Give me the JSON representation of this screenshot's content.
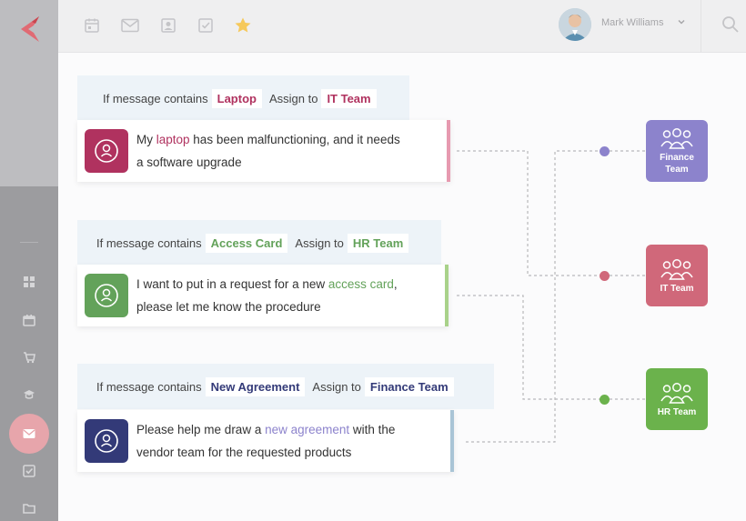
{
  "header": {
    "username": "Mark Williams",
    "icons": [
      "calendar-icon",
      "mail-icon",
      "contact-icon",
      "checkbox-icon",
      "star-icon",
      "search-icon"
    ]
  },
  "sidebar": {
    "icons": [
      "dashboard-icon",
      "calendar-icon",
      "cart-icon",
      "graduation-cap-icon",
      "mail-icon",
      "checkbox-icon",
      "folder-icon"
    ],
    "active": "mail-icon"
  },
  "colors": {
    "laptop": "#b0325f",
    "access": "#63a25a",
    "agreement": "#333a78",
    "it_team": "#d0687a",
    "finance_team": "#8c83cc",
    "hr_team": "#6bb24c"
  },
  "rules": [
    {
      "prefix": "If message contains",
      "keyword": "Laptop",
      "assign": "Assign to",
      "team": "IT Team",
      "message": {
        "before": "My ",
        "highlight": "laptop",
        "after_line1": " has been malfunctioning, and it needs",
        "line2": "a software upgrade"
      }
    },
    {
      "prefix": "If message contains",
      "keyword": "Access Card",
      "assign": "Assign to",
      "team": "HR Team",
      "message": {
        "before": "I want to put in a request for a new ",
        "highlight": "access card",
        "after_line1": ",",
        "line2": "please let me know the procedure"
      }
    },
    {
      "prefix": "If message contains",
      "keyword": "New Agreement",
      "assign": "Assign to",
      "team": "Finance Team",
      "message": {
        "before": "Please help me draw a ",
        "highlight": "new agreement",
        "after_line1": " with the",
        "line2": "vendor team for the requested products"
      }
    }
  ],
  "teams": [
    {
      "label_line1": "Finance",
      "label_line2": "Team"
    },
    {
      "label_line1": "IT Team",
      "label_line2": ""
    },
    {
      "label_line1": "HR Team",
      "label_line2": ""
    }
  ]
}
